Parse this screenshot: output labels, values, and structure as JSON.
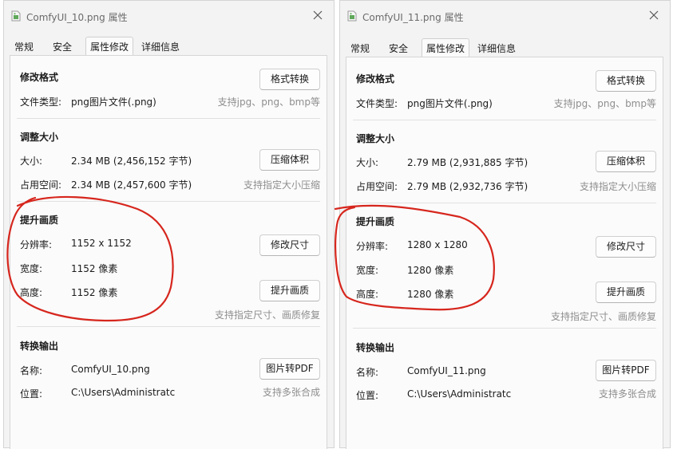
{
  "windows": [
    {
      "title": "ComfyUI_10.png 属性",
      "tabs": [
        "常规",
        "安全",
        "属性修改",
        "详细信息"
      ],
      "active_tab": "属性修改",
      "format": {
        "heading": "修改格式",
        "type_label": "文件类型:",
        "type_value": "png图片文件(.png)",
        "button": "格式转换",
        "hint": "支持jpg、png、bmp等"
      },
      "resize": {
        "heading": "调整大小",
        "size_label": "大小:",
        "size_value": "2.34 MB (2,456,152 字节)",
        "disk_label": "占用空间:",
        "disk_value": "2.34 MB (2,457,600 字节)",
        "button": "压缩体积",
        "hint": "支持指定大小压缩"
      },
      "quality": {
        "heading": "提升画质",
        "res_label": "分辨率:",
        "res_value": "1152 x 1152",
        "width_label": "宽度:",
        "width_value": "1152 像素",
        "height_label": "高度:",
        "height_value": "1152 像素",
        "resize_button": "修改尺寸",
        "enhance_button": "提升画质",
        "hint": "支持指定尺寸、画质修复"
      },
      "output": {
        "heading": "转换输出",
        "name_label": "名称:",
        "name_value": "ComfyUI_10.png",
        "loc_label": "位置:",
        "loc_value": "C:\\Users\\Administratc",
        "button": "图片转PDF",
        "hint": "支持多张合成"
      }
    },
    {
      "title": "ComfyUI_11.png 属性",
      "tabs": [
        "常规",
        "安全",
        "属性修改",
        "详细信息"
      ],
      "active_tab": "属性修改",
      "format": {
        "heading": "修改格式",
        "type_label": "文件类型:",
        "type_value": "png图片文件(.png)",
        "button": "格式转换",
        "hint": "支持jpg、png、bmp等"
      },
      "resize": {
        "heading": "调整大小",
        "size_label": "大小:",
        "size_value": "2.79 MB (2,931,885 字节)",
        "disk_label": "占用空间:",
        "disk_value": "2.79 MB (2,932,736 字节)",
        "button": "压缩体积",
        "hint": "支持指定大小压缩"
      },
      "quality": {
        "heading": "提升画质",
        "res_label": "分辨率:",
        "res_value": "1280 x 1280",
        "width_label": "宽度:",
        "width_value": "1280 像素",
        "height_label": "高度:",
        "height_value": "1280 像素",
        "resize_button": "修改尺寸",
        "enhance_button": "提升画质",
        "hint": "支持指定尺寸、画质修复"
      },
      "output": {
        "heading": "转换输出",
        "name_label": "名称:",
        "name_value": "ComfyUI_11.png",
        "loc_label": "位置:",
        "loc_value": "C:\\Users\\Administratc",
        "button": "图片转PDF",
        "hint": "支持多张合成"
      }
    }
  ],
  "colors": {
    "window_bg": "#f3f3f3",
    "panel_bg": "#fbfbfb",
    "hint_text": "#8e8e8e",
    "annotation_red": "#d6261d"
  },
  "icons": [
    "image-file-icon",
    "close-icon"
  ]
}
